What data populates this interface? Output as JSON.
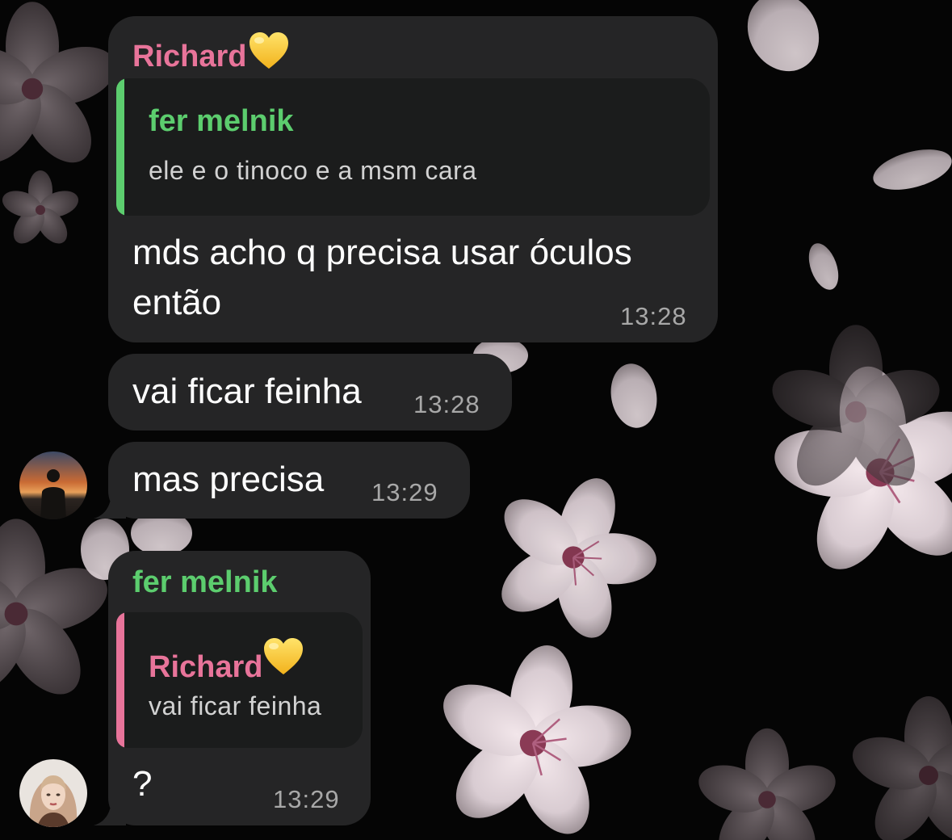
{
  "colors": {
    "bubble": "#252526",
    "quote_background": "#1b1c1c",
    "richard_name": "#e8749a",
    "fer_name": "#5ccd6e",
    "message_text": "#ffffff",
    "timestamp": "#a8a8a8",
    "wallpaper": "#050505"
  },
  "wallpaper": {
    "icon": "cherry-blossom-pattern"
  },
  "messages": [
    {
      "sender": "Richard",
      "sender_emoji": "yellow-heart",
      "reply": {
        "author": "fer melnik",
        "text": "ele e o tinoco e a msm cara"
      },
      "text_line1": "mds acho q precisa usar óculos",
      "text_line2": "então",
      "time": "13:28"
    },
    {
      "text": "vai ficar feinha",
      "time": "13:28"
    },
    {
      "text": "mas precisa",
      "time": "13:29",
      "avatar": "richard-avatar"
    },
    {
      "sender": "fer melnik",
      "reply": {
        "author": "Richard",
        "author_emoji": "yellow-heart",
        "text": "vai ficar feinha"
      },
      "text": "?",
      "time": "13:29",
      "avatar": "fer-avatar"
    }
  ]
}
